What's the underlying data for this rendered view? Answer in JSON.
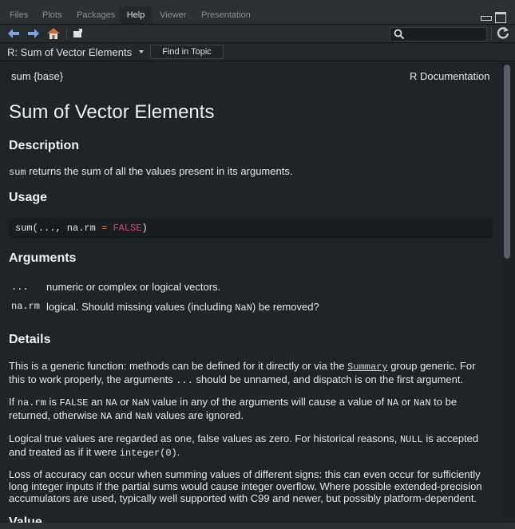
{
  "tabs": [
    {
      "label": "Files",
      "active": false
    },
    {
      "label": "Plots",
      "active": false
    },
    {
      "label": "Packages",
      "active": false
    },
    {
      "label": "Help",
      "active": true
    },
    {
      "label": "Viewer",
      "active": false
    },
    {
      "label": "Presentation",
      "active": false
    }
  ],
  "toolbar": {
    "back_icon": "back-arrow-icon",
    "forward_icon": "forward-arrow-icon",
    "home_icon": "home-icon",
    "popout_icon": "show-in-new-window-icon",
    "search_icon": "search-icon",
    "refresh_icon": "refresh-icon",
    "search_value": ""
  },
  "nav": {
    "topic": "R: Sum of Vector Elements",
    "find_button": "Find in Topic"
  },
  "doc": {
    "package_label": "sum {base}",
    "doc_label": "R Documentation",
    "title": "Sum of Vector Elements",
    "description_heading": "Description",
    "description_code": "sum",
    "description_text": " returns the sum of all the values present in its arguments.",
    "usage_heading": "Usage",
    "usage_code_pre": "sum(..., na.rm ",
    "usage_code_eq": "=",
    "usage_code_false": "FALSE",
    "usage_code_post": ")",
    "arguments_heading": "Arguments",
    "arguments": [
      {
        "name": "...",
        "desc": "numeric or complex or logical vectors."
      },
      {
        "name": "na.rm",
        "desc_pre": "logical. Should missing values (including ",
        "desc_code": "NaN",
        "desc_post": ") be removed?"
      }
    ],
    "details_heading": "Details",
    "details_p1": {
      "l1_pre": "This is a generic function: methods can be defined for it directly or via the ",
      "l1_link": "Summary",
      "l1_post": " group generic. For",
      "l2_pre": "this to work properly, the arguments ",
      "l2_code": "...",
      "l2_post": " should be unnamed, and dispatch is on the first argument."
    },
    "details_p2": {
      "t1": "If ",
      "c1": "na.rm",
      "t2": " is ",
      "c2": "FALSE",
      "t3": " an ",
      "c3": "NA",
      "t4": " or ",
      "c4": "NaN",
      "t5": " value in any of the arguments will cause a value of ",
      "c5": "NA",
      "t6": " or ",
      "c6": "NaN",
      "t7": " to be",
      "l2_t1": "returned, otherwise ",
      "l2_c1": "NA",
      "l2_t2": " and ",
      "l2_c2": "NaN",
      "l2_t3": " values are ignored."
    },
    "details_p3": {
      "l1_pre": "Logical true values are regarded as one, false values as zero. For historical reasons, ",
      "l1_code": "NULL",
      "l1_post": " is accepted",
      "l2_pre": "and treated as if it were ",
      "l2_code": "integer(0)",
      "l2_post": "."
    },
    "details_p4": {
      "l1": "Loss of accuracy can occur when summing values of different signs: this can even occur for sufficiently",
      "l2": "long integer inputs if the partial sums would cause integer overflow. Where possible extended-precision",
      "l3": "accumulators are used, typically well supported with C99 and newer, but possibly platform-dependent."
    },
    "next_heading_partial": "Value"
  },
  "colors": {
    "background": "#1f2428",
    "false_keyword": "#d04a7a",
    "eq_sign": "#e07b39"
  }
}
